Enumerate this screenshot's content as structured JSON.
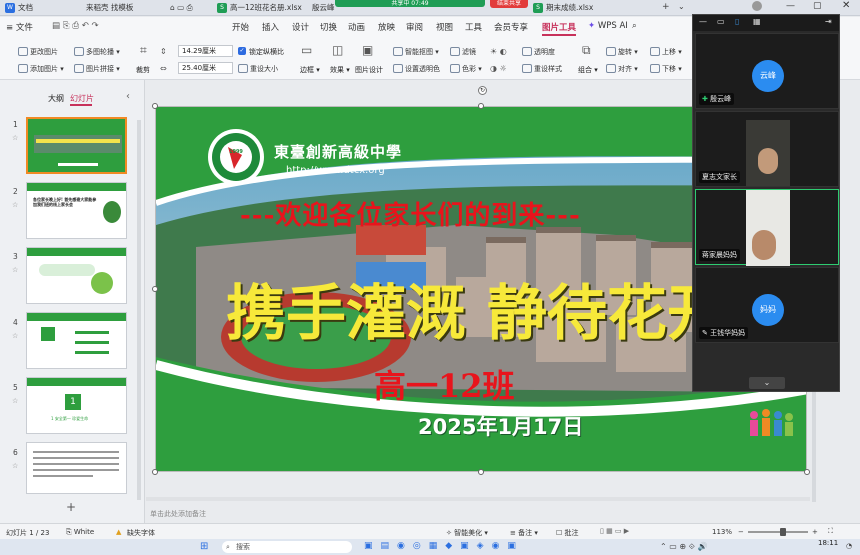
{
  "tabs": [
    {
      "label": "文档",
      "color": "#2b6fe0"
    },
    {
      "label": "来稻壳 找模板",
      "color": ""
    },
    {
      "label": "高一12班花名册.xlsx",
      "color": "#1f9d55"
    },
    {
      "label": "殷云峰",
      "color": ""
    },
    {
      "label": "期末成绩.xlsx",
      "color": "#1f9d55"
    }
  ],
  "share_banner": "共享中 07:49",
  "end_share": "结束共享",
  "file_menu": "文件",
  "menus": [
    "开始",
    "插入",
    "设计",
    "切换",
    "动画",
    "放映",
    "审阅",
    "视图",
    "工具",
    "会员专享",
    "图片工具",
    "WPS AI"
  ],
  "ribbon": {
    "change_picture": "更改图片",
    "add_picture": "添加图片",
    "multi_carousel": "多图轮播",
    "picture_collage": "图片拼接",
    "crop": "裁剪",
    "height": "14.29厘米",
    "width": "25.40厘米",
    "lock_ratio": "锁定纵横比",
    "reset_size": "重设大小",
    "outline": "边框",
    "effect": "效果",
    "picture_design": "图片设计",
    "smart_matting": "智能抠图",
    "set_transparent": "设置透明色",
    "filter": "滤镜",
    "color": "色彩",
    "transparency": "透明度",
    "reset_style": "重设样式",
    "combine": "组合",
    "rotate": "旋转",
    "align": "对齐",
    "move_up": "上移",
    "move_down": "下移"
  },
  "panel": {
    "outline_tab": "大纲",
    "slides_tab": "幻灯片",
    "thumbs": [
      {
        "num": "1",
        "text": ""
      },
      {
        "num": "2",
        "text": "各位家长晚上好! 首先感谢大家能参加我们班的线上家长会"
      },
      {
        "num": "3",
        "text": ""
      },
      {
        "num": "4",
        "text": ""
      },
      {
        "num": "5",
        "text": "1 安全第一 珍爱生命"
      },
      {
        "num": "6",
        "text": ""
      }
    ]
  },
  "slide": {
    "school_name": "東臺創新高級中學",
    "url": "http://www.dtcx.org",
    "welcome": "---欢迎各位家长们的到来---",
    "main_title": "携手灌溉  静待花开",
    "class_name": "高一12班",
    "date": "2025年1月17日",
    "logo_year": "1999"
  },
  "notes_placeholder": "单击此处添加备注",
  "status": {
    "slide_counter": "幻灯片 1 / 23",
    "theme": "White",
    "missing_font": "缺失字体",
    "beautify": "智能美化",
    "notes": "备注",
    "comments": "批注",
    "zoom": "113%"
  },
  "taskbar": {
    "search": "搜索",
    "time": "18:11"
  },
  "meeting": {
    "participants": [
      {
        "name": "殷云峰",
        "avatar_text": "云峰",
        "video": false
      },
      {
        "name": "夏志文家长",
        "avatar_text": "",
        "video": true
      },
      {
        "name": "蒋家晨妈妈",
        "avatar_text": "",
        "video": true
      },
      {
        "name": "王钱华妈妈",
        "avatar_text": "妈妈",
        "video": false
      }
    ]
  },
  "colors": {
    "accent": "#c7315b",
    "green": "#2e9e3e",
    "meeting_blue": "#2b8cf0"
  }
}
